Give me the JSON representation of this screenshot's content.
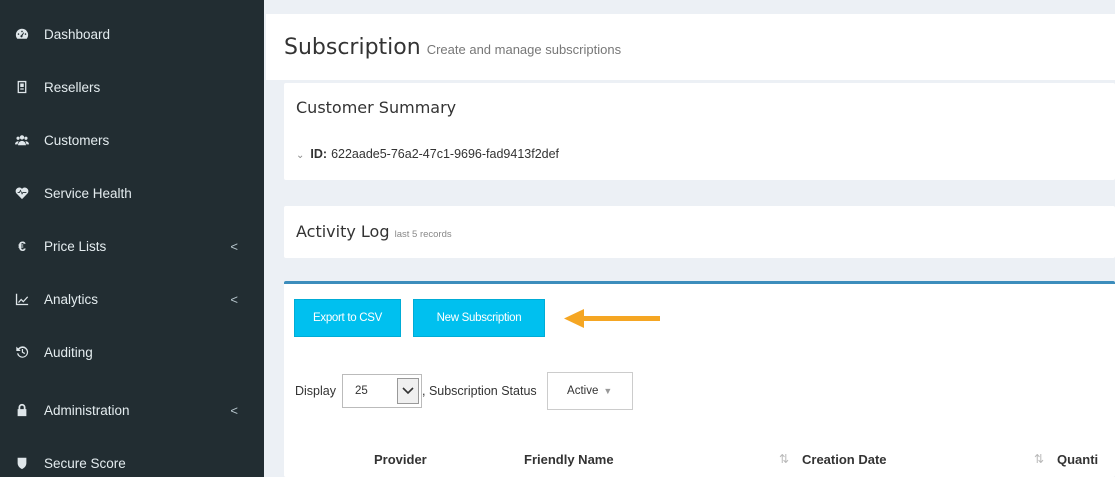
{
  "sidebar": {
    "items": [
      {
        "label": "Dashboard",
        "icon": "dashboard-icon",
        "chevron": ""
      },
      {
        "label": "Resellers",
        "icon": "reseller-icon",
        "chevron": ""
      },
      {
        "label": "Customers",
        "icon": "users-icon",
        "chevron": ""
      },
      {
        "label": "Service Health",
        "icon": "heartbeat-icon",
        "chevron": ""
      },
      {
        "label": "Price Lists",
        "icon": "euro-icon",
        "chevron": "<"
      },
      {
        "label": "Analytics",
        "icon": "line-chart-icon",
        "chevron": "<"
      },
      {
        "label": "Auditing",
        "icon": "history-icon",
        "chevron": ""
      },
      {
        "label": "Administration",
        "icon": "lock-icon",
        "chevron": "<"
      },
      {
        "label": "Secure Score",
        "icon": "shield-icon",
        "chevron": ""
      }
    ]
  },
  "header": {
    "title": "Subscription",
    "subtitle": "Create and manage subscriptions"
  },
  "summary": {
    "title": "Customer Summary",
    "id_label": "ID:",
    "id_value": "622aade5-76a2-47c1-9696-fad9413f2def"
  },
  "activity": {
    "title": "Activity Log",
    "note": "last 5 records"
  },
  "subscriptions": {
    "export_label": "Export to CSV",
    "new_label": "New Subscription",
    "display_label": "Display",
    "display_value": "25",
    "status_label": ", Subscription Status",
    "status_value": "Active",
    "columns": [
      "Provider",
      "Friendly Name",
      "Creation Date",
      "Quanti"
    ]
  },
  "colors": {
    "sidebar": "#222d32",
    "accent_button": "#00c0ef",
    "arrow": "#f5a623",
    "box_top_border": "#3c8dbc"
  }
}
